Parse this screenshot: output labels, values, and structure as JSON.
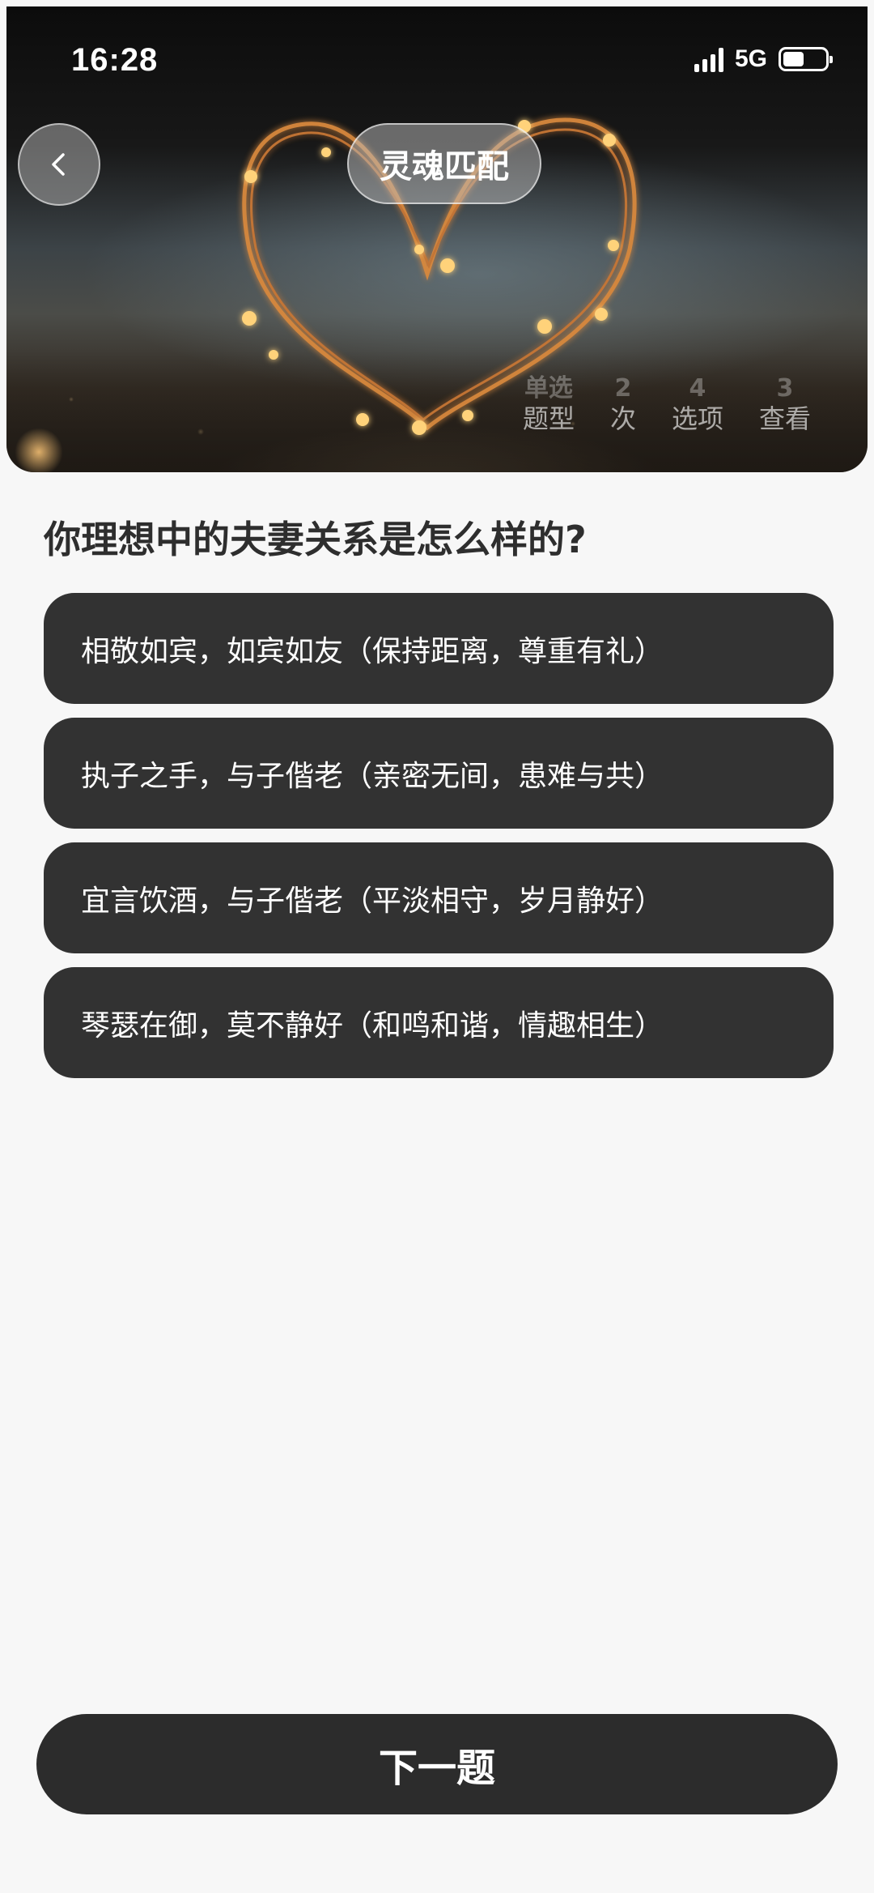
{
  "status_bar": {
    "time": "16:28",
    "network": "5G",
    "battery_level": 0.5
  },
  "header": {
    "title": "灵魂匹配",
    "back_icon": "chevron-left-icon"
  },
  "stats": [
    {
      "value": "单选",
      "label": "题型"
    },
    {
      "value": "2",
      "label": "次"
    },
    {
      "value": "4",
      "label": "选项"
    },
    {
      "value": "3",
      "label": "查看"
    }
  ],
  "question": {
    "text": "你理想中的夫妻关系是怎么样的?",
    "options": [
      "相敬如宾，如宾如友（保持距离，尊重有礼）",
      "执子之手，与子偕老（亲密无间，患难与共）",
      "宜言饮酒，与子偕老（平淡相守，岁月静好）",
      "琴瑟在御，莫不静好（和鸣和谐，情趣相生）"
    ]
  },
  "footer": {
    "next_label": "下一题"
  },
  "colors": {
    "option_bg": "#323232",
    "button_bg": "#2c2c2c",
    "page_bg": "#f7f7f7"
  }
}
